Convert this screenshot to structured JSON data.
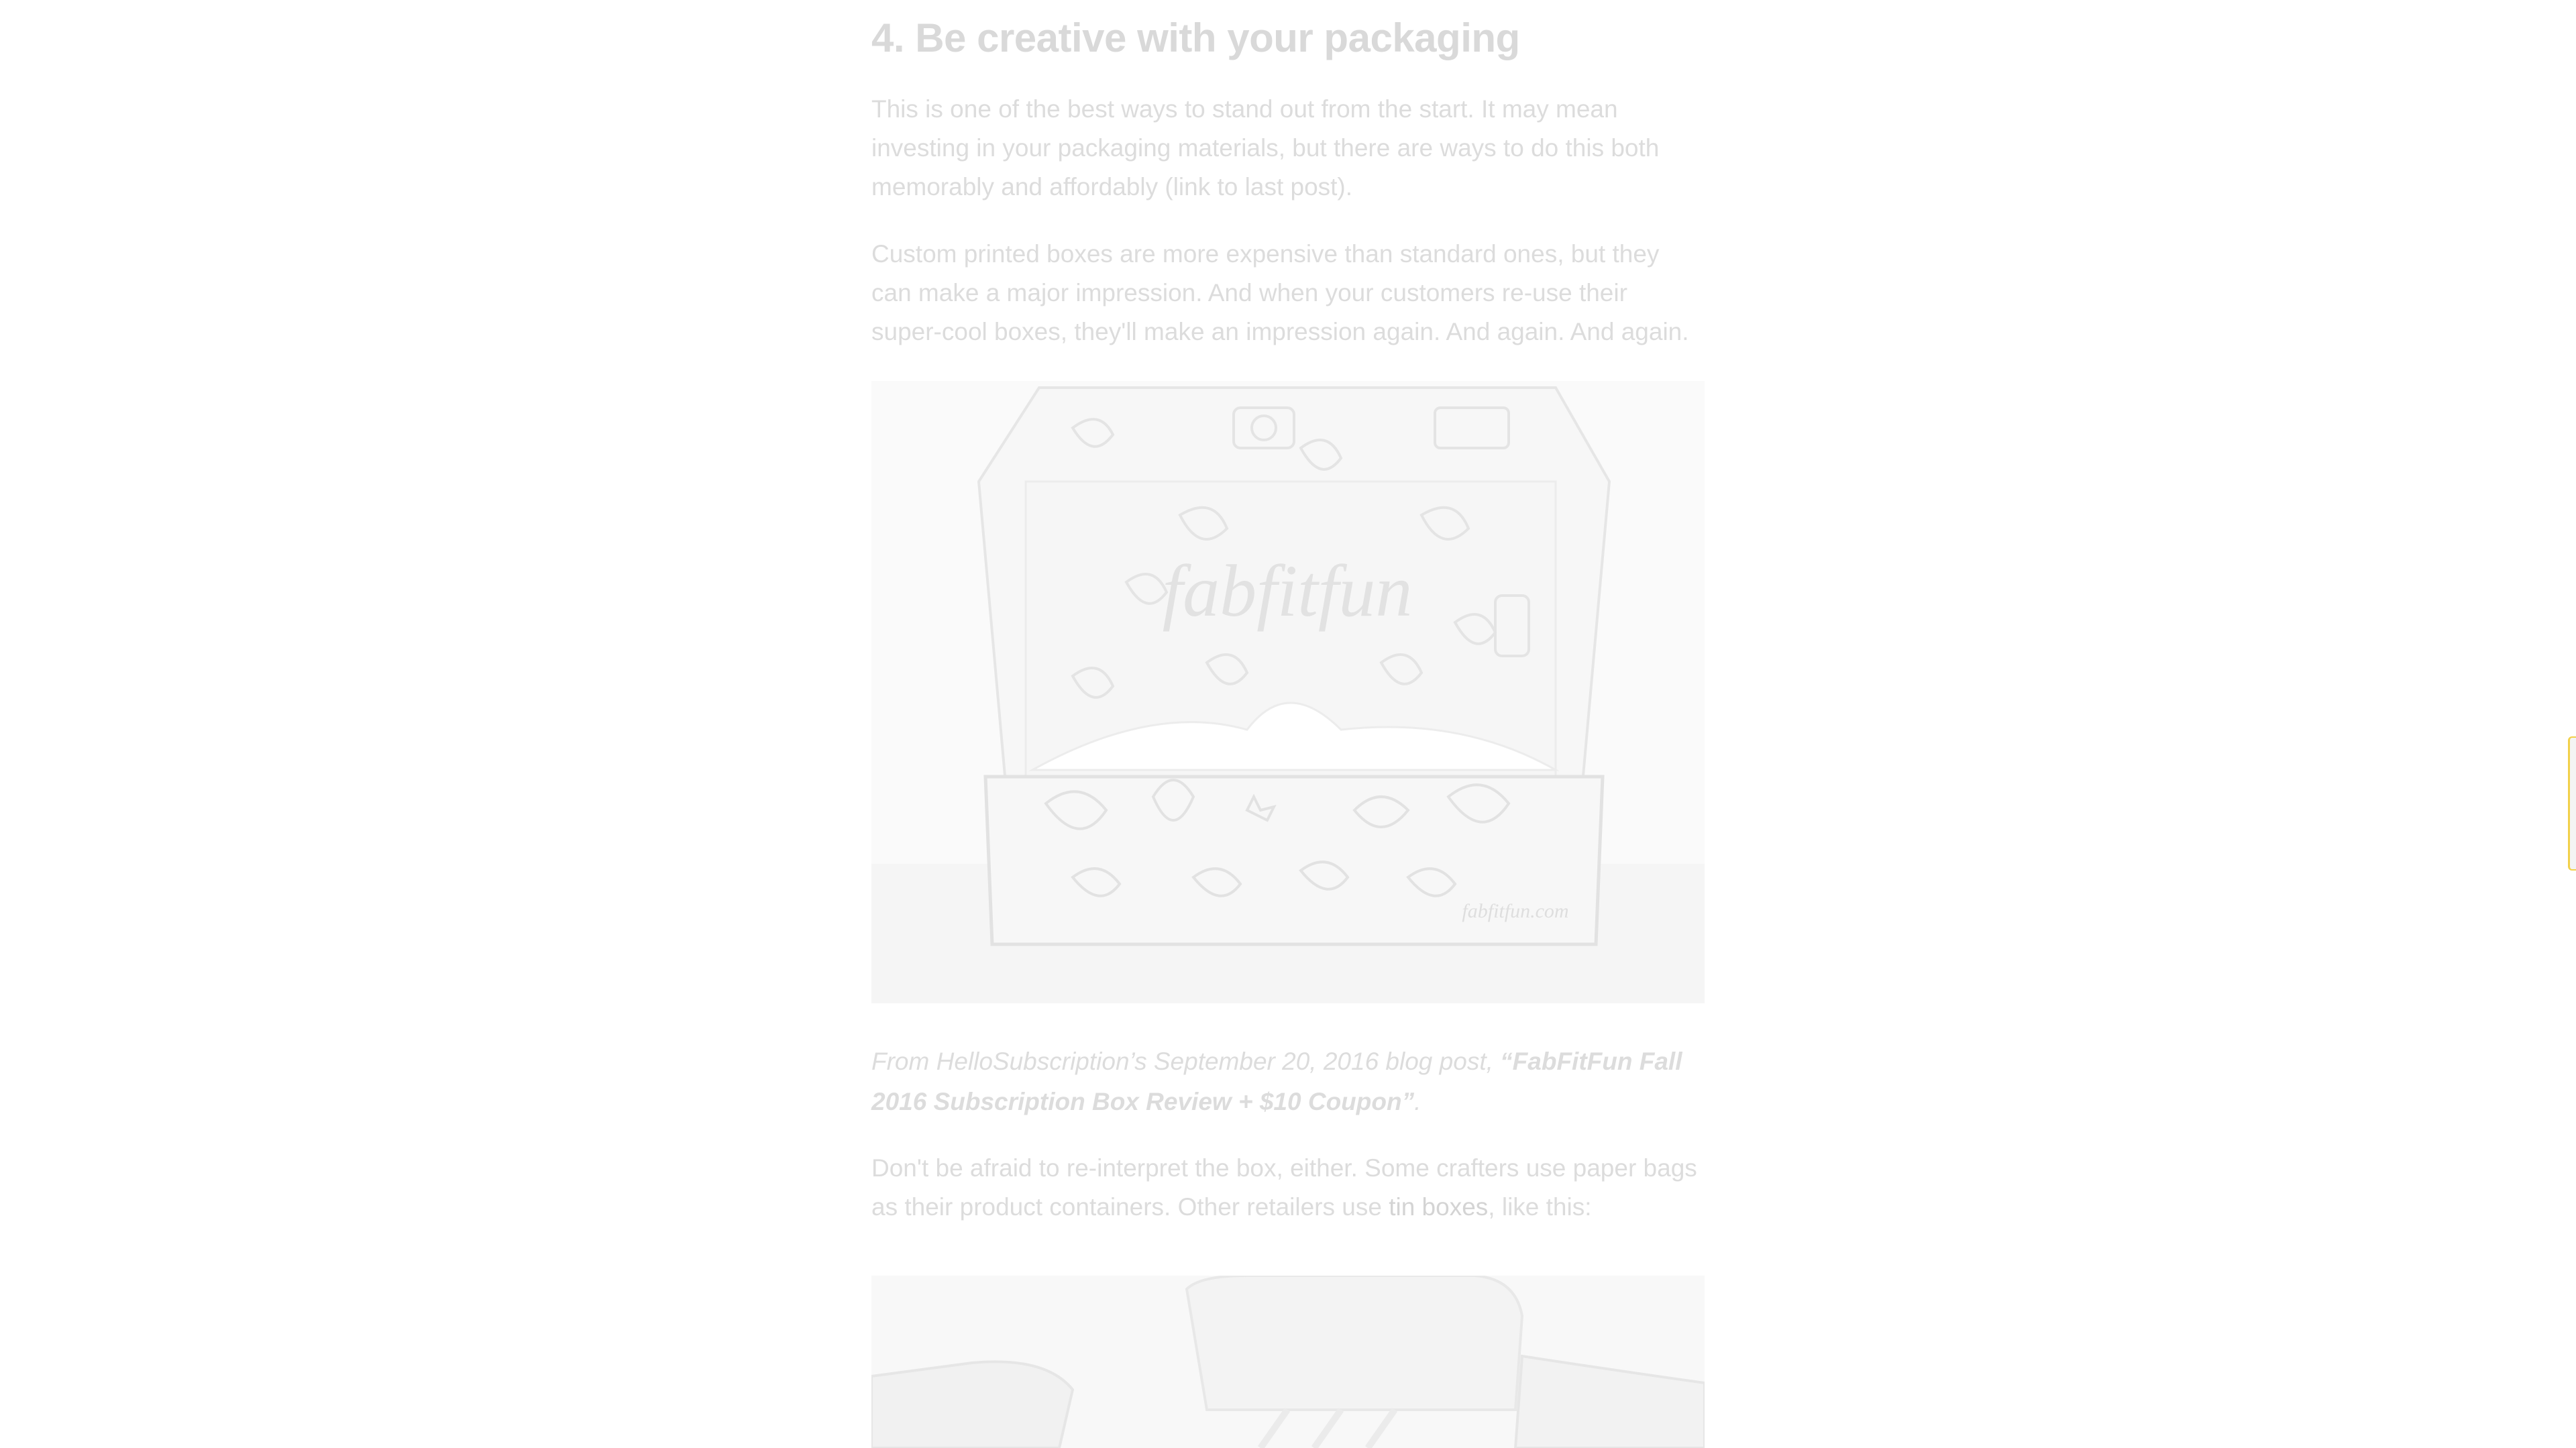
{
  "article": {
    "heading": "4. Be creative with your packaging",
    "paragraph_1": "This is one of the best ways to stand out from the start. It may mean investing in your packaging materials, but there are ways to do this both memorably and affordably (link to last post).",
    "paragraph_2": "Custom printed boxes are more expensive than standard ones, but they can make a major impression. And when your customers re-use their super-cool boxes, they'll make an impression again. And again. And again.",
    "box_image": {
      "logo_text": "fabfitfun",
      "front_logo_text": "fabfitfun.com"
    },
    "caption": {
      "prefix": "From HelloSubscription’s September 20, 2016 blog post, ",
      "link_text": "“FabFitFun Fall 2016 Subscription Box Review + $10 Coupon”",
      "suffix": "."
    },
    "paragraph_3": {
      "before_link": "Don't be afraid to re-interpret the box, either. Some crafters use paper bags as their product containers. Other retailers use ",
      "link_text": "tin boxes",
      "after_link": ", like this:"
    }
  },
  "colors": {
    "overlay_text": "#dcdcdc",
    "side_tab_accent": "#f2d14b"
  },
  "icons": {
    "side_tab": "feedback-tab"
  }
}
